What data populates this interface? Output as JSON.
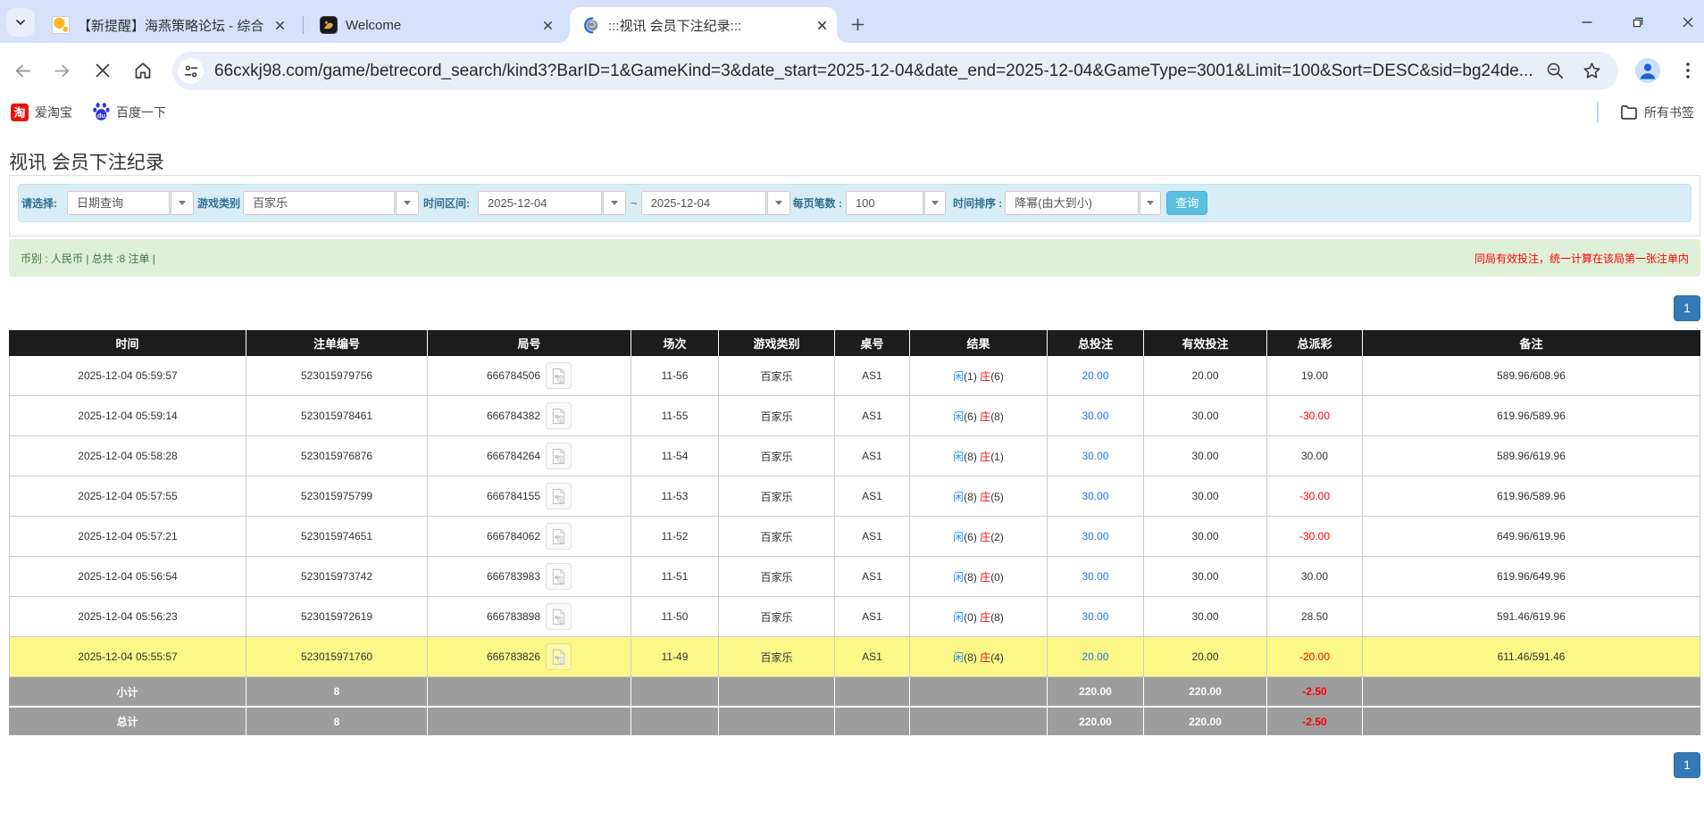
{
  "browser": {
    "tabs": [
      {
        "title": "【新提醒】海燕策略论坛 - 综合",
        "active": false
      },
      {
        "title": "Welcome",
        "active": false
      },
      {
        "title": ":::视讯 会员下注纪录:::",
        "active": true
      }
    ],
    "url": "66cxkj98.com/game/betrecord_search/kind3?BarID=1&GameKind=3&date_start=2025-12-04&date_end=2025-12-04&GameType=3001&Limit=100&Sort=DESC&sid=bg24de...",
    "bookmarks": [
      {
        "label": "爱淘宝"
      },
      {
        "label": "百度一下"
      }
    ],
    "all_bookmarks_label": "所有书签",
    "colors": {
      "tabstrip": "#d3e1fa",
      "accent_blue": "#337ab7"
    }
  },
  "page": {
    "title": "视讯 会员下注纪录",
    "filters": {
      "select_label": "请选择:",
      "select_value": "日期查询",
      "game_label": "游戏类别",
      "game_value": "百家乐",
      "range_label": "时间区间:",
      "date_start": "2025-12-04",
      "tilde": "~",
      "date_end": "2025-12-04",
      "page_size_label": "每页笔数 :",
      "page_size_value": "100",
      "sort_label": "时间排序 :",
      "sort_value": "降幂(由大到小)",
      "search_button": "查询"
    },
    "notice": {
      "left": "币别 : 人民币 | 总共 :8 注单 |",
      "right": "同局有效投注，统一计算在该局第一张注单内"
    },
    "pagination": "1",
    "table": {
      "headers": [
        "时间",
        "注单编号",
        "局号",
        "场次",
        "游戏类别",
        "桌号",
        "结果",
        "总投注",
        "有效投注",
        "总派彩",
        "备注"
      ],
      "rows": [
        {
          "time": "2025-12-04 05:59:57",
          "bet_id": "523015979756",
          "round": "666784506",
          "session": "11-56",
          "game": "百家乐",
          "table_no": "AS1",
          "res_p": "闲",
          "res_p_n": "(1)",
          "res_b": "庄",
          "res_b_n": "(6)",
          "total_bet": "20.00",
          "valid_bet": "20.00",
          "payout": "19.00",
          "payout_neg": false,
          "note": "589.96/608.96",
          "highlight": false
        },
        {
          "time": "2025-12-04 05:59:14",
          "bet_id": "523015978461",
          "round": "666784382",
          "session": "11-55",
          "game": "百家乐",
          "table_no": "AS1",
          "res_p": "闲",
          "res_p_n": "(6)",
          "res_b": "庄",
          "res_b_n": "(8)",
          "total_bet": "30.00",
          "valid_bet": "30.00",
          "payout": "-30.00",
          "payout_neg": true,
          "note": "619.96/589.96",
          "highlight": false
        },
        {
          "time": "2025-12-04 05:58:28",
          "bet_id": "523015976876",
          "round": "666784264",
          "session": "11-54",
          "game": "百家乐",
          "table_no": "AS1",
          "res_p": "闲",
          "res_p_n": "(8)",
          "res_b": "庄",
          "res_b_n": "(1)",
          "total_bet": "30.00",
          "valid_bet": "30.00",
          "payout": "30.00",
          "payout_neg": false,
          "note": "589.96/619.96",
          "highlight": false
        },
        {
          "time": "2025-12-04 05:57:55",
          "bet_id": "523015975799",
          "round": "666784155",
          "session": "11-53",
          "game": "百家乐",
          "table_no": "AS1",
          "res_p": "闲",
          "res_p_n": "(8)",
          "res_b": "庄",
          "res_b_n": "(5)",
          "total_bet": "30.00",
          "valid_bet": "30.00",
          "payout": "-30.00",
          "payout_neg": true,
          "note": "619.96/589.96",
          "highlight": false
        },
        {
          "time": "2025-12-04 05:57:21",
          "bet_id": "523015974651",
          "round": "666784062",
          "session": "11-52",
          "game": "百家乐",
          "table_no": "AS1",
          "res_p": "闲",
          "res_p_n": "(6)",
          "res_b": "庄",
          "res_b_n": "(2)",
          "total_bet": "30.00",
          "valid_bet": "30.00",
          "payout": "-30.00",
          "payout_neg": true,
          "note": "649.96/619.96",
          "highlight": false
        },
        {
          "time": "2025-12-04 05:56:54",
          "bet_id": "523015973742",
          "round": "666783983",
          "session": "11-51",
          "game": "百家乐",
          "table_no": "AS1",
          "res_p": "闲",
          "res_p_n": "(8)",
          "res_b": "庄",
          "res_b_n": "(0)",
          "total_bet": "30.00",
          "valid_bet": "30.00",
          "payout": "30.00",
          "payout_neg": false,
          "note": "619.96/649.96",
          "highlight": false
        },
        {
          "time": "2025-12-04 05:56:23",
          "bet_id": "523015972619",
          "round": "666783898",
          "session": "11-50",
          "game": "百家乐",
          "table_no": "AS1",
          "res_p": "闲",
          "res_p_n": "(0)",
          "res_b": "庄",
          "res_b_n": "(8)",
          "total_bet": "30.00",
          "valid_bet": "30.00",
          "payout": "28.50",
          "payout_neg": false,
          "note": "591.46/619.96",
          "highlight": false
        },
        {
          "time": "2025-12-04 05:55:57",
          "bet_id": "523015971760",
          "round": "666783826",
          "session": "11-49",
          "game": "百家乐",
          "table_no": "AS1",
          "res_p": "闲",
          "res_p_n": "(8)",
          "res_b": "庄",
          "res_b_n": "(4)",
          "total_bet": "20.00",
          "valid_bet": "20.00",
          "payout": "-20.00",
          "payout_neg": true,
          "note": "611.46/591.46",
          "highlight": true
        }
      ],
      "subtotal": {
        "label": "小计",
        "count": "8",
        "total_bet": "220.00",
        "valid_bet": "220.00",
        "payout": "-2.50"
      },
      "grand_total": {
        "label": "总计",
        "count": "8",
        "total_bet": "220.00",
        "valid_bet": "220.00",
        "payout": "-2.50"
      }
    }
  }
}
